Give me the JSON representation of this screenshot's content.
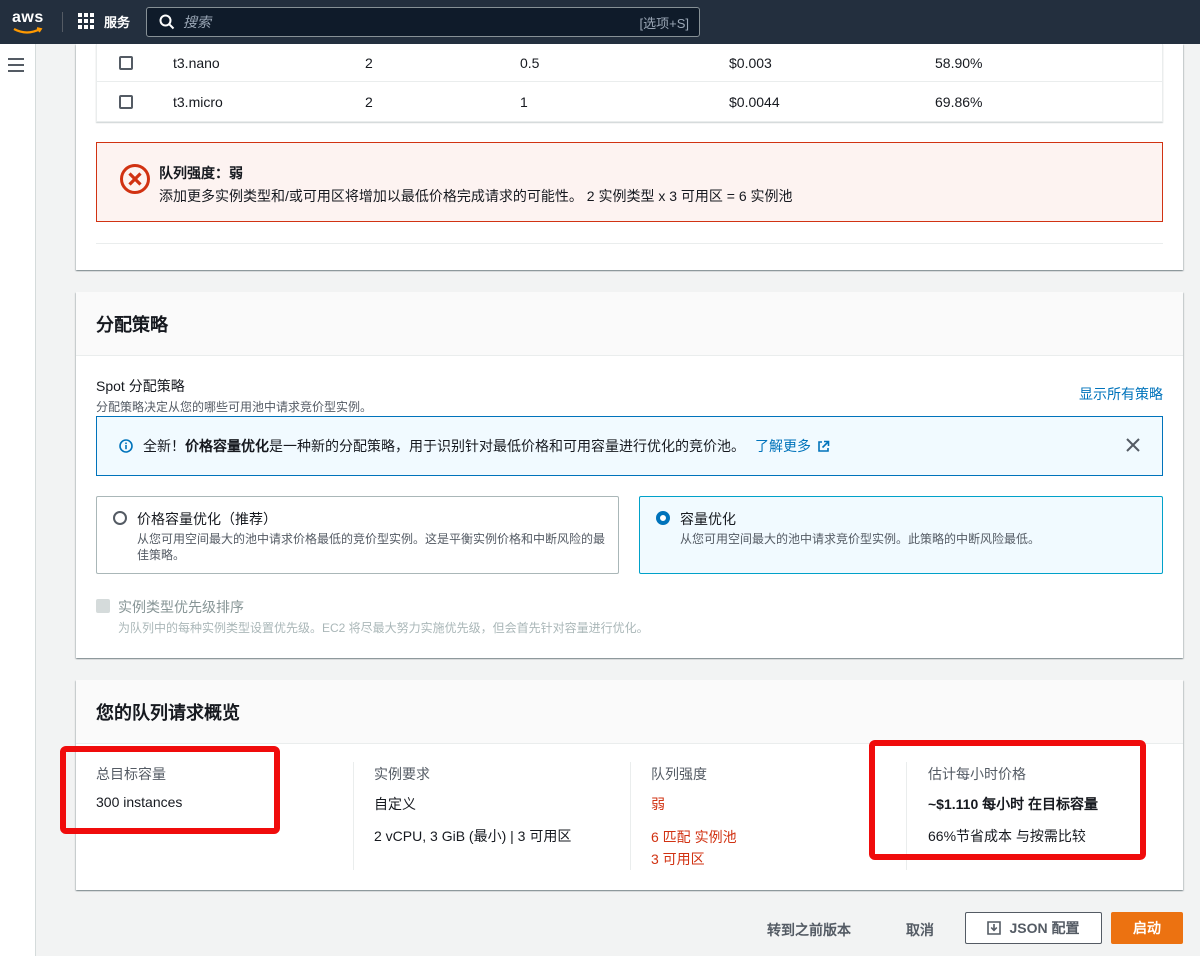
{
  "nav": {
    "logo": "aws",
    "services_label": "服务",
    "search_placeholder": "搜索",
    "search_shortcut": "[选项+S]"
  },
  "instance_table": {
    "rows": [
      {
        "type": "t3.nano",
        "vcpu": "2",
        "memory": "0.5",
        "price": "$0.003",
        "savings": "58.90%"
      },
      {
        "type": "t3.micro",
        "vcpu": "2",
        "memory": "1",
        "price": "$0.0044",
        "savings": "69.86%"
      }
    ]
  },
  "fleet_alert": {
    "title": "队列强度：弱",
    "body": "添加更多实例类型和/或可用区将增加以最低价格完成请求的可能性。 2 实例类型 x 3 可用区 = 6 实例池"
  },
  "allocation": {
    "header": "分配策略",
    "spot_label": "Spot 分配策略",
    "spot_desc": "分配策略决定从您的哪些可用池中请求竞价型实例。",
    "show_all": "显示所有策略",
    "info_prefix": "全新！",
    "info_bold": "价格容量优化",
    "info_rest": "是一种新的分配策略，用于识别针对最低价格和可用容量进行优化的竞价池。",
    "learn_more": "了解更多",
    "options": [
      {
        "title": "价格容量优化（推荐）",
        "desc": "从您可用空间最大的池中请求价格最低的竞价型实例。这是平衡实例价格和中断风险的最佳策略。",
        "selected": false
      },
      {
        "title": "容量优化",
        "desc": "从您可用空间最大的池中请求竞价型实例。此策略的中断风险最低。",
        "selected": true
      }
    ],
    "priority_label": "实例类型优先级排序",
    "priority_desc": "为队列中的每种实例类型设置优先级。EC2 将尽最大努力实施优先级，但会首先针对容量进行优化。"
  },
  "summary": {
    "header": "您的队列请求概览",
    "target_label": "总目标容量",
    "target_value": "300 instances",
    "req_label": "实例要求",
    "req_value": "自定义",
    "req_detail": "2 vCPU, 3 GiB (最小) | 3 可用区",
    "strength_label": "队列强度",
    "strength_value": "弱",
    "strength_pools": "6 匹配 实例池",
    "strength_azs": "3 可用区",
    "price_label": "估计每小时价格",
    "price_value": "~$1.110 每小时 在目标容量",
    "price_savings": "66%节省成本 与按需比较"
  },
  "footer": {
    "prev_version": "转到之前版本",
    "cancel": "取消",
    "json_config": "JSON 配置",
    "launch": "启动"
  },
  "colors": {
    "nav_bg": "#232f3e",
    "link": "#0073bb",
    "error": "#d13212",
    "primary_button": "#ec7211",
    "highlight_box": "#f00c0c"
  }
}
